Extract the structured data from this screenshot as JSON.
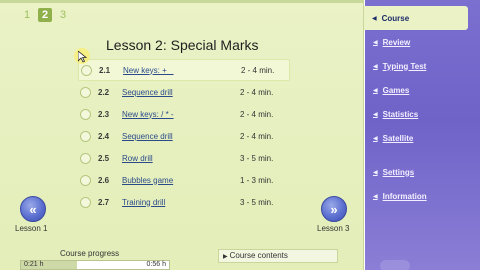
{
  "pages": [
    "1",
    "2",
    "3"
  ],
  "active_page": "2",
  "lesson_title": "Lesson 2: Special Marks",
  "drills": [
    {
      "num": "2.1",
      "name": "New keys: + _",
      "time": "2 - 4 min."
    },
    {
      "num": "2.2",
      "name": "Sequence drill",
      "time": "2 - 4 min."
    },
    {
      "num": "2.3",
      "name": "New keys: / * -",
      "time": "2 - 4 min."
    },
    {
      "num": "2.4",
      "name": "Sequence drill",
      "time": "2 - 4 min."
    },
    {
      "num": "2.5",
      "name": "Row drill",
      "time": "3 - 5 min."
    },
    {
      "num": "2.6",
      "name": "Bubbles game",
      "time": "1 - 3 min."
    },
    {
      "num": "2.7",
      "name": "Training drill",
      "time": "3 - 5 min."
    }
  ],
  "nav": {
    "prev_label": "Lesson 1",
    "next_label": "Lesson 3",
    "prev_icon": "double-left-arrow-icon",
    "next_icon": "double-right-arrow-icon"
  },
  "progress": {
    "label": "Course progress",
    "left_time": "0:21 h",
    "right_time": "0:56 h",
    "fraction": 0.375
  },
  "course_contents_label": "Course contents",
  "sidebar": {
    "items": [
      {
        "label": "Course",
        "active": true
      },
      {
        "label": "Review",
        "active": false
      },
      {
        "label": "Typing Test",
        "active": false
      },
      {
        "label": "Games",
        "active": false
      },
      {
        "label": "Statistics",
        "active": false
      },
      {
        "label": "Satellite",
        "active": false
      }
    ],
    "secondary": [
      {
        "label": "Settings"
      },
      {
        "label": "Information"
      }
    ]
  },
  "colors": {
    "main_bg": "#e3eeb9",
    "sidebar_bg": "#6f63c8",
    "link": "#2a4a8a",
    "nav_button": "#5b6fd0"
  }
}
